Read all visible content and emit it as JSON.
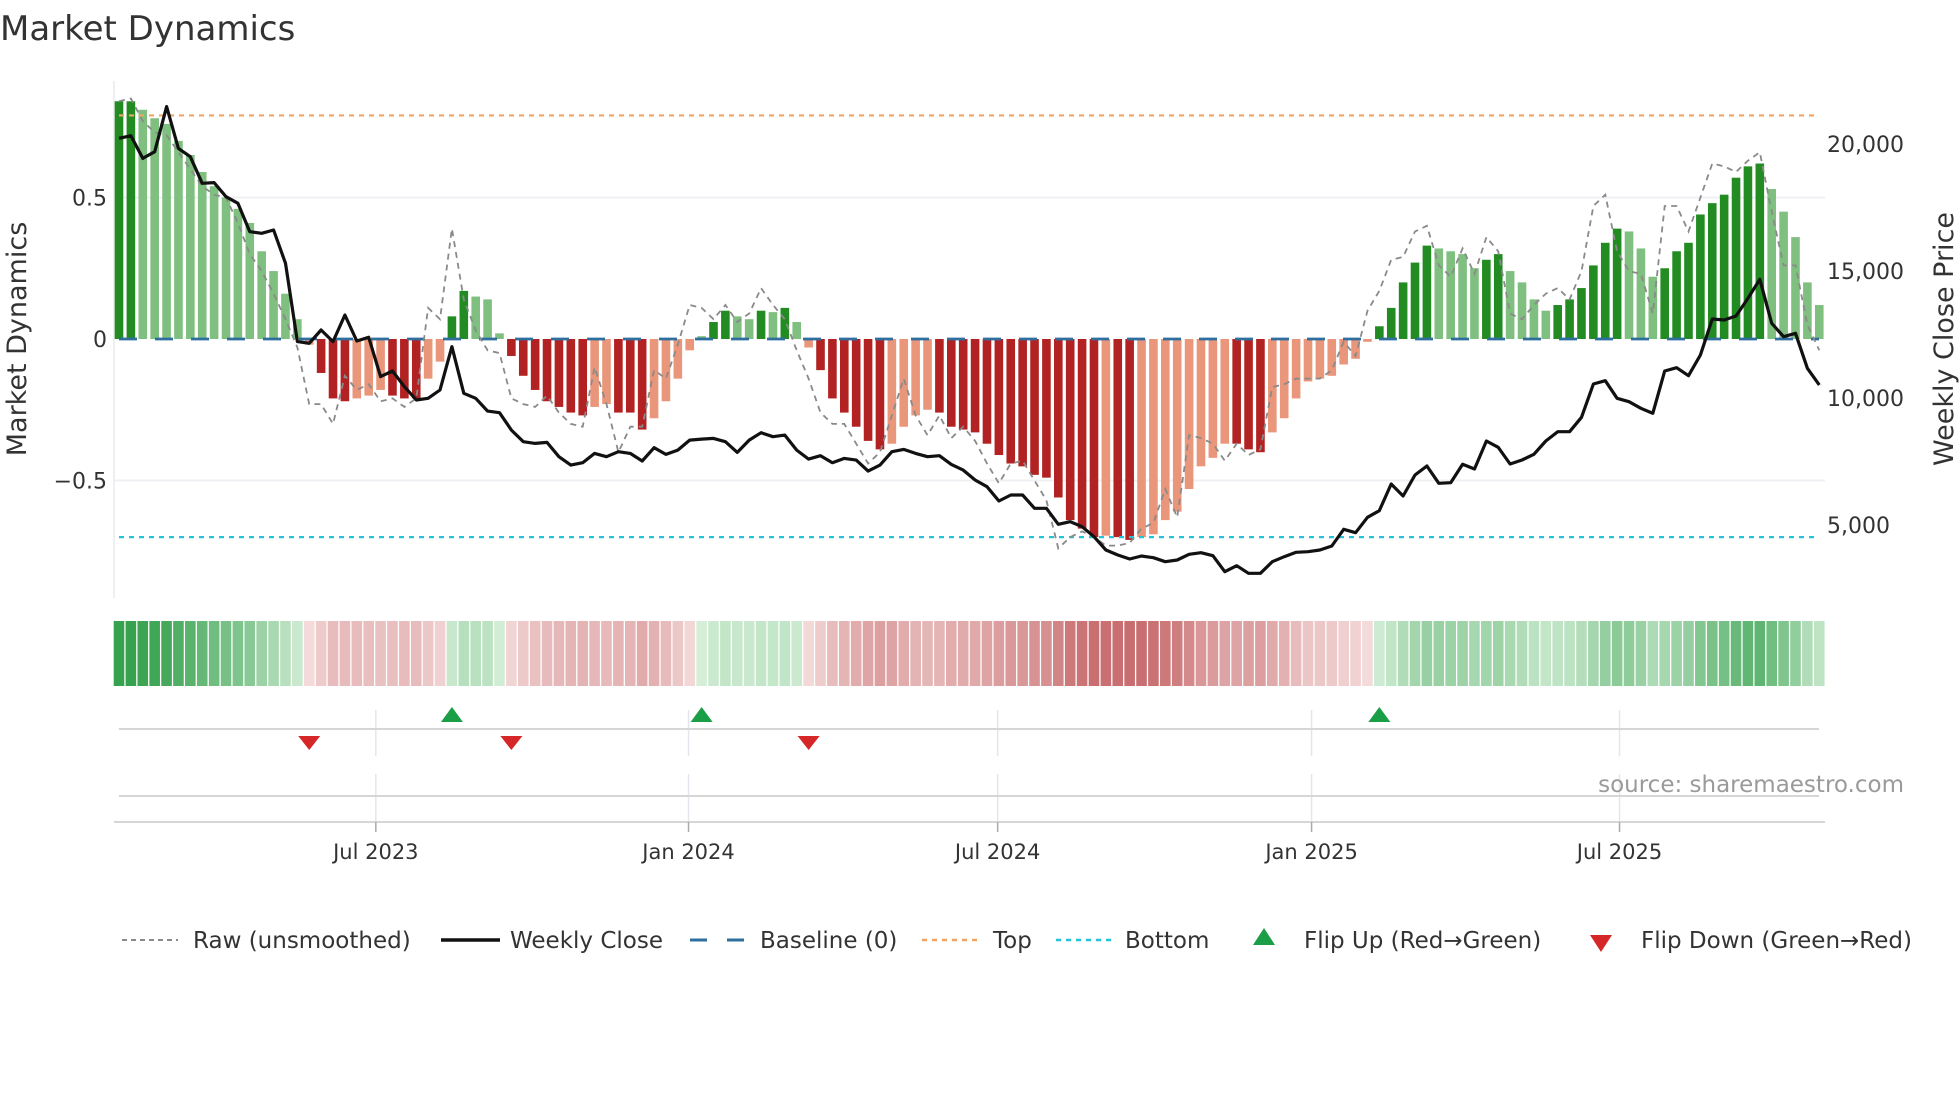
{
  "chart_data": {
    "type": "bar",
    "title": "Market Dynamics",
    "ylabel": "Market Dynamics",
    "y2label": "Weekly Close Price",
    "ylim": [
      -0.95,
      0.95
    ],
    "y2lim": [
      2000,
      22000
    ],
    "yticks": [
      {
        "value": 0.5,
        "label": "0.5"
      },
      {
        "value": 0,
        "label": "0"
      },
      {
        "value": -0.5,
        "label": "−0.5"
      }
    ],
    "y2ticks": [
      {
        "value": 20000,
        "label": "20,000"
      },
      {
        "value": 15000,
        "label": "15,000"
      },
      {
        "value": 10000,
        "label": "10,000"
      },
      {
        "value": 5000,
        "label": "5,000"
      }
    ],
    "xticks": [
      {
        "week": 22.6,
        "label": "Jul 2023"
      },
      {
        "week": 48.9,
        "label": "Jan 2024"
      },
      {
        "week": 74.9,
        "label": "Jul 2024"
      },
      {
        "week": 101.3,
        "label": "Jan 2025"
      },
      {
        "week": 127.2,
        "label": "Jul 2025"
      }
    ],
    "top_level": 0.79,
    "bottom_level": -0.7,
    "baseline": 0,
    "smoothed": [
      0.84,
      0.84,
      0.81,
      0.78,
      0.76,
      0.7,
      0.65,
      0.59,
      0.54,
      0.5,
      0.46,
      0.41,
      0.31,
      0.24,
      0.16,
      0.07,
      -0.02,
      -0.12,
      -0.21,
      -0.22,
      -0.21,
      -0.2,
      -0.18,
      -0.2,
      -0.21,
      -0.21,
      -0.14,
      -0.08,
      0.08,
      0.17,
      0.15,
      0.14,
      0.02,
      -0.06,
      -0.13,
      -0.18,
      -0.22,
      -0.24,
      -0.26,
      -0.27,
      -0.24,
      -0.23,
      -0.26,
      -0.26,
      -0.32,
      -0.28,
      -0.22,
      -0.14,
      -0.04,
      0.01,
      0.06,
      0.1,
      0.08,
      0.07,
      0.1,
      0.095,
      0.11,
      0.06,
      -0.03,
      -0.11,
      -0.21,
      -0.26,
      -0.31,
      -0.36,
      -0.39,
      -0.37,
      -0.31,
      -0.27,
      -0.25,
      -0.26,
      -0.31,
      -0.32,
      -0.33,
      -0.37,
      -0.41,
      -0.44,
      -0.45,
      -0.48,
      -0.49,
      -0.56,
      -0.64,
      -0.67,
      -0.7,
      -0.695,
      -0.7,
      -0.71,
      -0.7,
      -0.69,
      -0.64,
      -0.61,
      -0.53,
      -0.45,
      -0.42,
      -0.37,
      -0.37,
      -0.39,
      -0.4,
      -0.33,
      -0.28,
      -0.21,
      -0.15,
      -0.14,
      -0.13,
      -0.09,
      -0.07,
      -0.01,
      0.045,
      0.11,
      0.2,
      0.27,
      0.33,
      0.32,
      0.31,
      0.3,
      0.25,
      0.28,
      0.3,
      0.24,
      0.2,
      0.14,
      0.1,
      0.12,
      0.14,
      0.18,
      0.26,
      0.34,
      0.39,
      0.38,
      0.32,
      0.22,
      0.25,
      0.31,
      0.34,
      0.44,
      0.48,
      0.51,
      0.57,
      0.61,
      0.62,
      0.53,
      0.45,
      0.36,
      0.2,
      0.12
    ],
    "raw": [
      0.84,
      0.85,
      0.77,
      0.73,
      0.72,
      0.66,
      0.6,
      0.54,
      0.51,
      0.5,
      0.41,
      0.3,
      0.24,
      0.16,
      0.07,
      -0.03,
      -0.23,
      -0.23,
      -0.3,
      -0.13,
      -0.18,
      -0.16,
      -0.22,
      -0.21,
      -0.24,
      -0.21,
      0.11,
      0.07,
      0.39,
      0.14,
      0.03,
      -0.04,
      -0.05,
      -0.21,
      -0.23,
      -0.24,
      -0.2,
      -0.26,
      -0.3,
      -0.31,
      -0.1,
      -0.23,
      -0.4,
      -0.31,
      -0.31,
      -0.11,
      -0.14,
      -0.02,
      0.12,
      0.11,
      0.07,
      0.12,
      0.06,
      0.09,
      0.18,
      0.12,
      0.07,
      -0.04,
      -0.14,
      -0.26,
      -0.3,
      -0.3,
      -0.37,
      -0.44,
      -0.4,
      -0.27,
      -0.14,
      -0.27,
      -0.34,
      -0.27,
      -0.35,
      -0.31,
      -0.36,
      -0.44,
      -0.51,
      -0.44,
      -0.43,
      -0.5,
      -0.57,
      -0.74,
      -0.7,
      -0.68,
      -0.7,
      -0.73,
      -0.73,
      -0.72,
      -0.67,
      -0.65,
      -0.53,
      -0.63,
      -0.34,
      -0.35,
      -0.37,
      -0.43,
      -0.37,
      -0.41,
      -0.39,
      -0.17,
      -0.16,
      -0.14,
      -0.14,
      -0.14,
      -0.11,
      -0.01,
      -0.06,
      0.1,
      0.17,
      0.28,
      0.29,
      0.38,
      0.4,
      0.26,
      0.22,
      0.32,
      0.23,
      0.36,
      0.31,
      0.09,
      0.07,
      0.12,
      0.16,
      0.18,
      0.14,
      0.24,
      0.47,
      0.51,
      0.31,
      0.24,
      0.23,
      0.09,
      0.47,
      0.47,
      0.38,
      0.5,
      0.62,
      0.61,
      0.59,
      0.63,
      0.66,
      0.45,
      0.26,
      0.26,
      0.05,
      -0.04
    ],
    "weekly_close": [
      20213,
      20318,
      19425,
      19688,
      21460,
      19818,
      19491,
      18443,
      18470,
      17918,
      17656,
      16542,
      16477,
      16608,
      15296,
      12215,
      12150,
      12673,
      12215,
      13263,
      12240,
      12385,
      10838,
      11060,
      10445,
      9920,
      9985,
      10314,
      12018,
      10183,
      9985,
      9484,
      9418,
      8734,
      8277,
      8212,
      8250,
      7690,
      7360,
      7452,
      7820,
      7690,
      7885,
      7820,
      7518,
      8043,
      7780,
      7950,
      8343,
      8383,
      8410,
      8277,
      7858,
      8343,
      8632,
      8475,
      8540,
      7950,
      7596,
      7727,
      7452,
      7622,
      7557,
      7124,
      7360,
      7885,
      7977,
      7820,
      7690,
      7727,
      7386,
      7163,
      6772,
      6510,
      5946,
      6182,
      6182,
      5658,
      5658,
      5028,
      5133,
      4936,
      4543,
      4018,
      3822,
      3664,
      3782,
      3717,
      3559,
      3625,
      3848,
      3913,
      3795,
      3166,
      3402,
      3100,
      3100,
      3559,
      3756,
      3927,
      3953,
      4018,
      4176,
      4831,
      4700,
      5304,
      5566,
      6615,
      6143,
      6969,
      7323,
      6641,
      6667,
      7388,
      7205,
      8306,
      8057,
      7401,
      7559,
      7782,
      8306,
      8674,
      8674,
      9237,
      10548,
      10680,
      9985,
      9854,
      9591,
      9395,
      11060,
      11191,
      10877,
      11689,
      13106,
      13066,
      13224,
      13916,
      14666,
      12935,
      12410,
      12542,
      11165,
      10509
    ],
    "flips": [
      {
        "week": 17,
        "direction": "down"
      },
      {
        "week": 29,
        "direction": "up"
      },
      {
        "week": 34,
        "direction": "down"
      },
      {
        "week": 50,
        "direction": "up"
      },
      {
        "week": 59,
        "direction": "down"
      },
      {
        "week": 107,
        "direction": "up"
      }
    ],
    "legend": {
      "placement": "bottom",
      "items": [
        {
          "key": "raw",
          "label": "Raw (unsmoothed)"
        },
        {
          "key": "close",
          "label": "Weekly Close"
        },
        {
          "key": "baseline",
          "label": "Baseline (0)"
        },
        {
          "key": "top",
          "label": "Top"
        },
        {
          "key": "bottom",
          "label": "Bottom"
        },
        {
          "key": "flip_up",
          "label": "Flip Up (Red→Green)"
        },
        {
          "key": "flip_down",
          "label": "Flip Down (Green→Red)"
        }
      ]
    },
    "source": "source: sharemaestro.com",
    "colors": {
      "pos_strong": "#228b22",
      "pos_weak": "#7fbf7f",
      "neg_strong": "#b22222",
      "neg_weak": "#e9967a",
      "raw": "#8a8a8a",
      "close": "#111111",
      "baseline": "#2f6f9f",
      "top": "#f4a460",
      "bottom": "#22c5d8",
      "flip_up": "#1a9e46",
      "flip_down": "#d62728"
    }
  }
}
